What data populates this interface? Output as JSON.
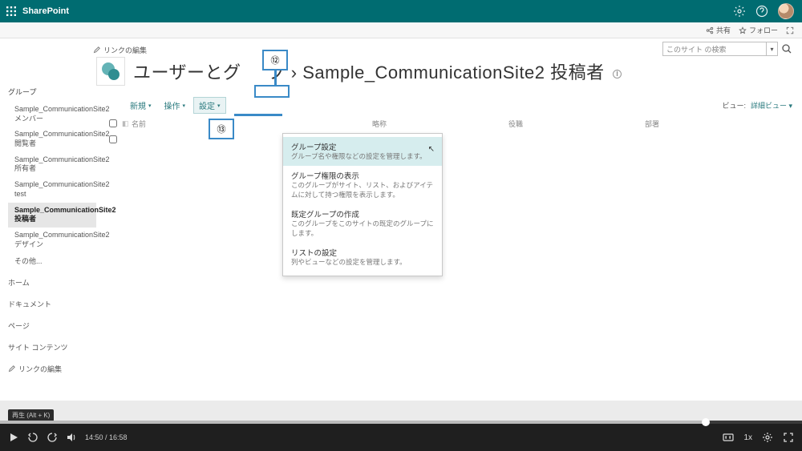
{
  "suite": {
    "app": "SharePoint"
  },
  "ribbon": {
    "share": "共有",
    "follow": "フォロー"
  },
  "search": {
    "placeholder": "このサイト の検索"
  },
  "editLinksLabel": "リンクの編集",
  "pageTitle": {
    "prefix": "ユーザーとグ",
    "mid": "プ",
    "sep": "›",
    "group": "Sample_CommunicationSite2 投稿者"
  },
  "leftnav": {
    "section": "グループ",
    "items": [
      "Sample_CommunicationSite2 メンバー",
      "Sample_CommunicationSite2 閲覧者",
      "Sample_CommunicationSite2 所有者",
      "Sample_CommunicationSite2 test",
      "Sample_CommunicationSite2 投稿者",
      "Sample_CommunicationSite2 デザイン"
    ],
    "more": "その他...",
    "roots": [
      "ホーム",
      "ドキュメント",
      "ページ",
      "サイト コンテンツ"
    ]
  },
  "toolbar": {
    "new": "新規",
    "actions": "操作",
    "settings": "設定",
    "viewLabel": "ビュー:",
    "viewValue": "詳細ビュー"
  },
  "columns": {
    "name": "名前",
    "c2": "略称",
    "c3": "役職",
    "c4": "部署"
  },
  "menu": {
    "items": [
      {
        "title": "グループ設定",
        "desc": "グループ名や権限などの設定を管理します。"
      },
      {
        "title": "グループ権限の表示",
        "desc": "このグループがサイト、リスト、およびアイテムに対して持つ権限を表示します。"
      },
      {
        "title": "既定グループの作成",
        "desc": "このグループをこのサイトの既定のグループにします。"
      },
      {
        "title": "リストの設定",
        "desc": "列やビューなどの設定を管理します。"
      }
    ]
  },
  "annotations": {
    "a12": "⑫",
    "a13": "⑬"
  },
  "player": {
    "alt": "再生 (Alt + K)",
    "time": "14:50 / 16:58",
    "speed": "1x",
    "progressPct": 88
  }
}
